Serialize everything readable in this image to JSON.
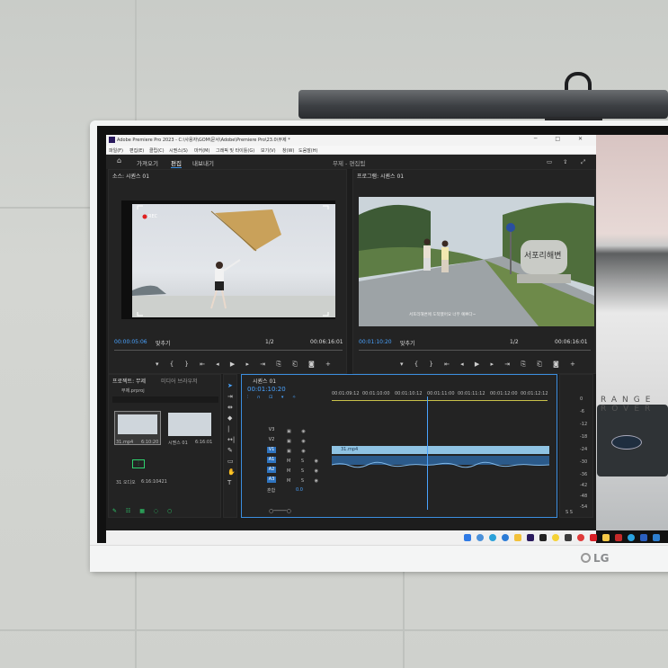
{
  "window": {
    "title": "Adobe Premiere Pro 2023 - C:\\사용자\\GOM\\문서\\Adobe\\Premiere Pro\\23.0\\무제 *",
    "controls": "─ □ ✕"
  },
  "menu": [
    "파일(F)",
    "편집(E)",
    "클립(C)",
    "시퀀스(S)",
    "마커(M)",
    "그래픽 및 타이틀(G)",
    "보기(V)",
    "창(W)",
    "도움말(H)"
  ],
  "workspace": {
    "tabs": [
      "가져오기",
      "편집",
      "내보내기"
    ],
    "active_tab": "편집",
    "project_label": "무제 - 편집됨"
  },
  "source_monitor": {
    "title": "소스: 시퀀스 01",
    "timecode_left": "00:00:05:06",
    "fit": "맞추기",
    "zoom": "1/2",
    "timecode_right": "00:06:16:01",
    "rec_label": "REC"
  },
  "program_monitor": {
    "title": "프로그램: 시퀀스 01",
    "timecode_left": "00:01:10:20",
    "fit": "맞추기",
    "zoom": "1/2",
    "timecode_right": "00:06:16:01",
    "sign_text": "서포리해변",
    "subtitle": "서포리해변에 도착했어요 너무 예쁘다~"
  },
  "project_panel": {
    "tabs": [
      "프로젝트: 무제",
      "미디어 브라우저"
    ],
    "file": "무제.prproj",
    "items": [
      {
        "name": "31.mp4",
        "duration": "6:10:20"
      },
      {
        "name": "시퀀스 01",
        "duration": "6:16:01"
      },
      {
        "name": "31 오디오",
        "duration": "6:16:10421"
      }
    ]
  },
  "timeline": {
    "title": "시퀀스 01",
    "timecode": "00:01:10:20",
    "ruler": [
      "00:01:09:12",
      "00:01:10:00",
      "00:01:10:12",
      "00:01:11:00",
      "00:01:11:12",
      "00:01:12:00",
      "00:01:12:12"
    ],
    "video_tracks": [
      "V3",
      "V2",
      "V1"
    ],
    "audio_tracks": [
      "A1",
      "A2",
      "A3"
    ],
    "master": "혼합",
    "master_value": "0.0",
    "clip_name": "31.mp4"
  },
  "meter": {
    "scale": [
      "0",
      "-6",
      "-12",
      "-18",
      "-24",
      "-30",
      "-36",
      "-42",
      "-48",
      "-54"
    ],
    "footer": "S S"
  },
  "car_text": "RANGE ROVER",
  "monitor_brand": "LG",
  "colors": {
    "accent": "#4aa3ff",
    "track_tag": "#2f74c0",
    "video_clip": "#8fc3e3",
    "audio_clip": "#2b5a8a"
  }
}
